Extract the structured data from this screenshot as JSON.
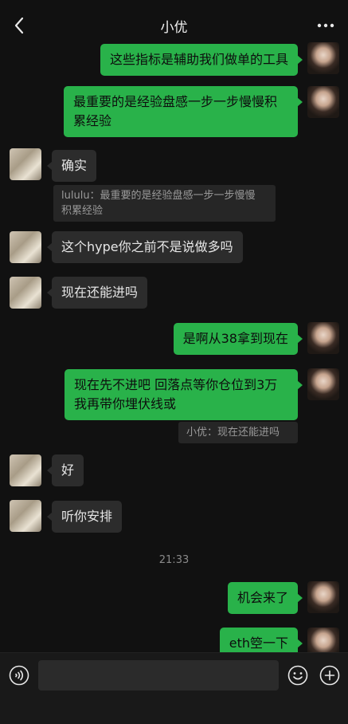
{
  "header": {
    "title": "小优"
  },
  "messages": [
    {
      "side": "out",
      "text": "这些指标是辅助我们做单的工具"
    },
    {
      "side": "out",
      "text": "最重要的是经验盘感一步一步慢慢积\n累经验"
    },
    {
      "side": "in",
      "text": "确实"
    },
    {
      "side": "quote",
      "text": "lululu：最重要的是经验盘感一步一步慢慢\n积累经验"
    },
    {
      "side": "in",
      "text": "这个hype你之前不是说做多吗"
    },
    {
      "side": "in",
      "text": "现在还能进吗"
    },
    {
      "side": "out",
      "text": "是啊从38拿到现在"
    },
    {
      "side": "out",
      "text": "现在先不进吧 回落点等你仓位到3万\n我再带你埋伏线或"
    },
    {
      "side": "quote",
      "text": "小优：现在还能进吗"
    },
    {
      "side": "in",
      "text": "好"
    },
    {
      "side": "in",
      "text": "听你安排"
    },
    {
      "side": "time",
      "text": "21:33"
    },
    {
      "side": "out",
      "text": "机会来了"
    },
    {
      "side": "out",
      "text": "eth箜一下"
    }
  ],
  "icons": {
    "back": "chevron-left-icon",
    "more": "more-dots-icon",
    "voice": "voice-icon",
    "emoji": "emoji-icon",
    "add": "plus-icon"
  },
  "colors": {
    "background": "#111111",
    "outgoing_bubble": "#29b24a",
    "incoming_bubble": "#2c2c2c"
  }
}
